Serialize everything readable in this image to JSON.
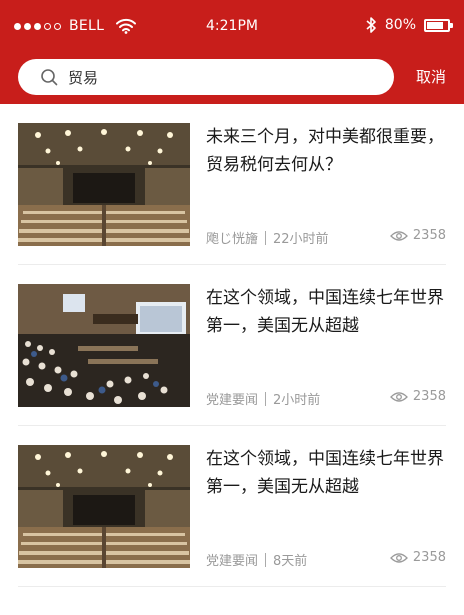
{
  "status_bar": {
    "carrier": "BELL",
    "time": "4:21PM",
    "battery": "80%",
    "battery_level": 0.8
  },
  "search": {
    "value": "贸易",
    "cancel_label": "取消"
  },
  "articles": [
    {
      "title": "未来三个月，对中美都很重要，贸易税何去何从？",
      "source": "飑じ恍旝",
      "time": "22小时前",
      "views": "2358",
      "image": "conference-hall"
    },
    {
      "title": "在这个领域，中国连续七年世界第一，美国无从超越",
      "source": "党建要闻",
      "time": "2小时前",
      "views": "2358",
      "image": "conference-meeting"
    },
    {
      "title": "在这个领域，中国连续七年世界第一，美国无从超越",
      "source": "党建要闻",
      "time": "8天前",
      "views": "2358",
      "image": "conference-hall"
    }
  ],
  "colors": {
    "brand_red": "#c81e1b",
    "meta_gray": "#9a9a9a"
  }
}
